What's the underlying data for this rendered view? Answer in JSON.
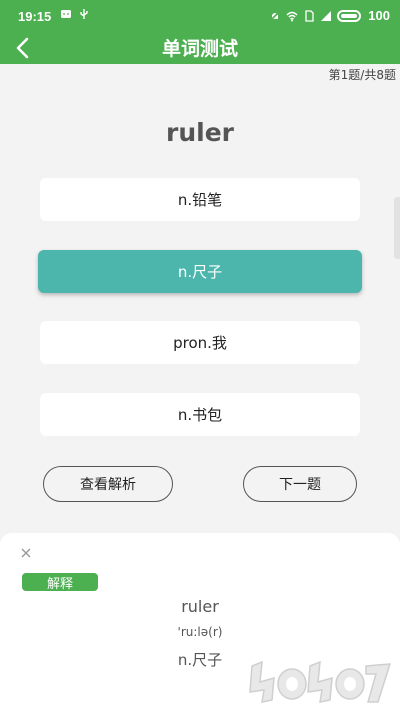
{
  "status_bar": {
    "time": "19:15",
    "battery": "100",
    "icons": [
      "message-icon",
      "usb-icon",
      "silent-icon",
      "wifi-icon",
      "sim-icon",
      "signal-icon",
      "battery-icon"
    ]
  },
  "app_bar": {
    "title": "单词测试",
    "back_icon": "chevron-left-icon"
  },
  "progress": "第1题/共8题",
  "question": {
    "word": "ruler",
    "options": [
      {
        "label": "n.铅笔",
        "selected": false
      },
      {
        "label": "n.尺子",
        "selected": true
      },
      {
        "label": "pron.我",
        "selected": false
      },
      {
        "label": "n.书包",
        "selected": false
      }
    ]
  },
  "actions": {
    "view_analysis": "查看解析",
    "next": "下一题"
  },
  "explanation": {
    "tag": "解释",
    "word": "ruler",
    "phonetic": "'ru:lə(r)",
    "meaning": "n.尺子"
  },
  "colors": {
    "primary_green": "#4caf50",
    "selected_teal": "#4db6ac",
    "background": "#f3f3f3"
  }
}
